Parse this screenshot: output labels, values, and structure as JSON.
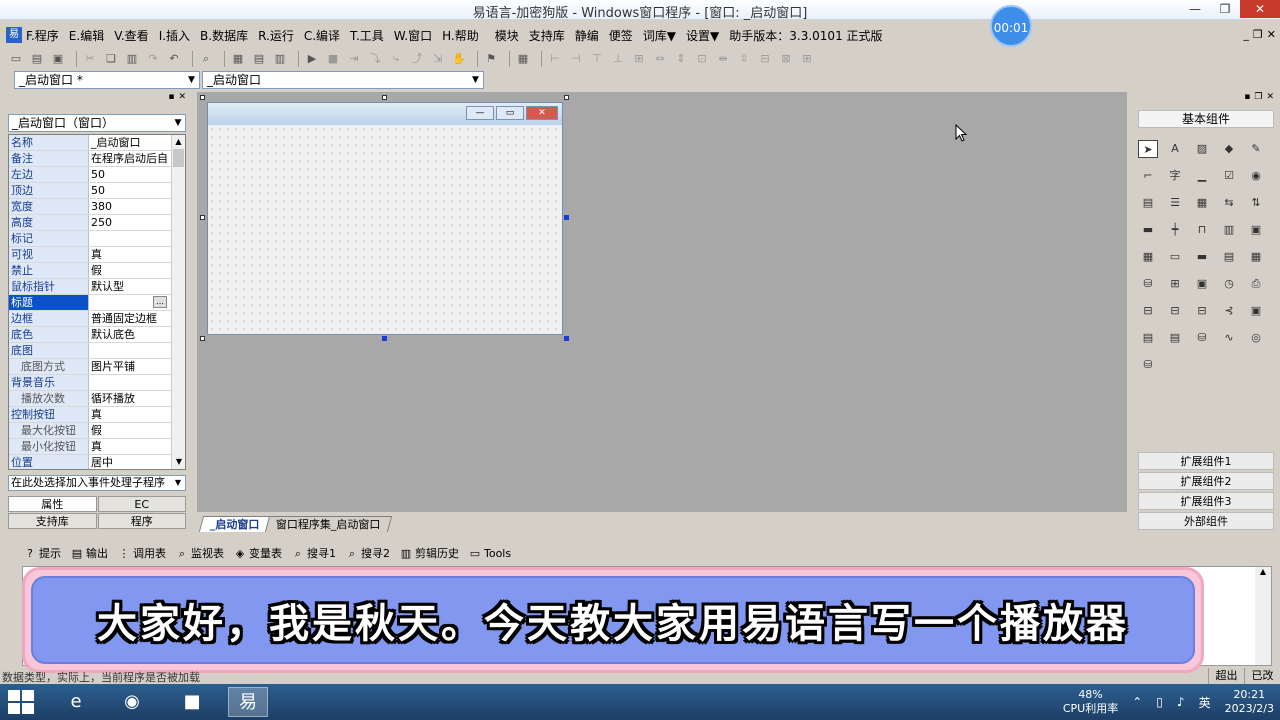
{
  "window": {
    "title": "易语言-加密狗版 - Windows窗口程序 - [窗口: _启动窗口]",
    "timer": "00:01"
  },
  "menubar": {
    "items": [
      "F.程序",
      "E.编辑",
      "V.查看",
      "I.插入",
      "B.数据库",
      "R.运行",
      "C.编译",
      "T.工具",
      "W.窗口",
      "H.帮助"
    ],
    "extra": [
      "模块",
      "支持库",
      "静编",
      "便签",
      "词库▼",
      "设置▼"
    ],
    "version": "助手版本：3.3.0101 正式版"
  },
  "combos": {
    "left": "_启动窗口 *",
    "right": "_启动窗口"
  },
  "properties": {
    "object_combo": "_启动窗口（窗口）",
    "rows": [
      {
        "name": "名称",
        "value": "_启动窗口",
        "sub": false
      },
      {
        "name": "备注",
        "value": "在程序启动后自",
        "sub": false
      },
      {
        "name": "左边",
        "value": "50",
        "sub": false
      },
      {
        "name": "顶边",
        "value": "50",
        "sub": false
      },
      {
        "name": "宽度",
        "value": "380",
        "sub": false
      },
      {
        "name": "高度",
        "value": "250",
        "sub": false
      },
      {
        "name": "标记",
        "value": "",
        "sub": false
      },
      {
        "name": "可视",
        "value": "真",
        "sub": false
      },
      {
        "name": "禁止",
        "value": "假",
        "sub": false
      },
      {
        "name": "鼠标指针",
        "value": "默认型",
        "sub": false
      },
      {
        "name": "标题",
        "value": "",
        "sub": false
      },
      {
        "name": "边框",
        "value": "普通固定边框",
        "sub": false
      },
      {
        "name": "底色",
        "value": "默认底色",
        "sub": false
      },
      {
        "name": "底图",
        "value": "",
        "sub": false
      },
      {
        "name": "底图方式",
        "value": "图片平铺",
        "sub": true
      },
      {
        "name": "背景音乐",
        "value": "",
        "sub": false
      },
      {
        "name": "播放次数",
        "value": "循环播放",
        "sub": true
      },
      {
        "name": "控制按钮",
        "value": "真",
        "sub": false
      },
      {
        "name": "最大化按钮",
        "value": "假",
        "sub": true
      },
      {
        "name": "最小化按钮",
        "value": "真",
        "sub": true
      },
      {
        "name": "位置",
        "value": "居中",
        "sub": false
      }
    ],
    "selected_row": "标题",
    "event_combo": "在此处选择加入事件处理子程序",
    "tabs": [
      "属性",
      "EC",
      "支持库",
      "程序"
    ]
  },
  "doc_tabs": [
    "_启动窗口",
    "窗口程序集_启动窗口"
  ],
  "components": {
    "title": "基本组件",
    "icons": [
      "pointer-icon",
      "label-icon",
      "picture-box-icon",
      "shape-icon",
      "drawing-board-icon",
      "group-box-icon",
      "text-icon",
      "button-icon",
      "checkbox-icon",
      "radio-icon",
      "combo-icon",
      "list-icon",
      "checklist-icon",
      "scrollbar-h-icon",
      "scrollbar-v-icon",
      "progress-icon",
      "slider-icon",
      "tab-icon",
      "date-icon",
      "calendar-icon",
      "grid-icon",
      "link-icon",
      "status-icon",
      "doc-icon",
      "table-icon",
      "data-source-icon",
      "layout-icon",
      "database-icon",
      "timer-icon",
      "printer-icon",
      "client-icon",
      "server-icon",
      "port-icon",
      "socket-icon",
      "data-icon",
      "odbc-source-icon",
      "odbc-link-icon",
      "db-provider-icon",
      "chart-icon",
      "odbc-icon",
      "odbc-db-icon"
    ],
    "categories": [
      "扩展组件1",
      "扩展组件2",
      "扩展组件3",
      "外部组件"
    ]
  },
  "output_tabs": [
    "提示",
    "输出",
    "调用表",
    "监视表",
    "变量表",
    "搜寻1",
    "搜寻2",
    "剪辑历史",
    "Tools"
  ],
  "subtitle": "大家好，我是秋天。今天教大家用易语言写一个播放器",
  "statusbar": {
    "text": "数据类型，实际上，当前程序是否被加载",
    "overwrite": "超出",
    "mode": "已改"
  },
  "taskbar": {
    "cpu_percent": "48%",
    "cpu_label": "CPU利用率",
    "ime": "英",
    "time": "20:21",
    "date": "2023/2/3"
  }
}
